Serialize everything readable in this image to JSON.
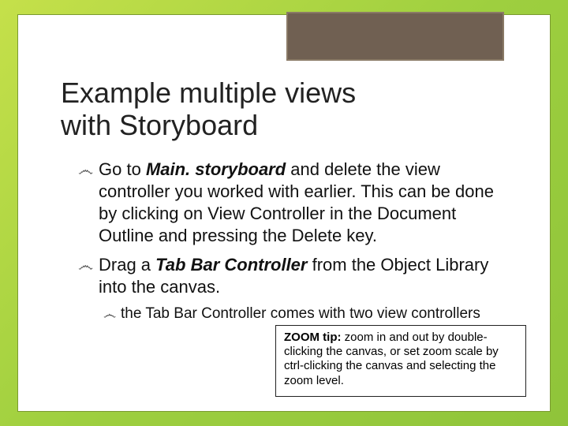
{
  "title_line1": "Example multiple views",
  "title_line2": "with Storyboard",
  "bullets": {
    "b1_pre": "Go",
    "b1_mid": " to ",
    "b1_file": "Main. storyboard",
    "b1_rest": " and delete the view controller you worked with earlier. This can be done by clicking on View Controller in the Document Outline and pressing the Delete key.",
    "b2_pre": "Drag",
    "b2_mid": " a ",
    "b2_item": "Tab Bar Controller",
    "b2_rest": " from the Object Library into the canvas.",
    "s1_pre": "the",
    "s1_rest": " Tab Bar Controller comes with two view controllers"
  },
  "tip": {
    "label": "ZOOM tip:  ",
    "text": "zoom in and out by double-clicking the canvas, or set zoom scale by ctrl-clicking the canvas and selecting the zoom level."
  },
  "glyphs": {
    "swirl": "෴"
  }
}
